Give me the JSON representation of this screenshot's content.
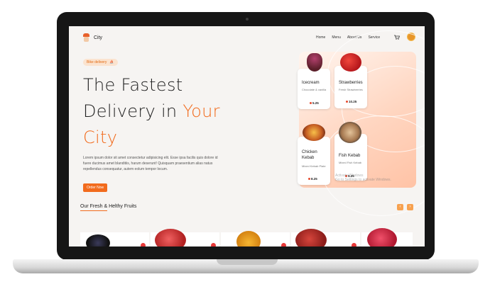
{
  "brand": {
    "name": "City"
  },
  "nav": {
    "items": [
      "Home",
      "Menu",
      "About Us",
      "Service"
    ],
    "cart_icon": "cart-icon",
    "avatar_icon": "avatar"
  },
  "hero": {
    "badge_label": "Bike delivery",
    "badge_icon": "scooter-icon",
    "line1": "The Fastest",
    "line2_prefix": "Delivery in",
    "line2_accent": "Your",
    "line3_accent": "City",
    "description": "Lorem ipsum dolor sit amet consectetur adipisicing elit. Esse ipsa facilis quis dolore id fuere ducimus amet blanditiis, harum deserunt! Quisquam praesentium alias natus repellendus consequatur, autem eolum tempor locum.",
    "order_button": "Order Now"
  },
  "featured": [
    {
      "name": "Icecream",
      "subtitle": "Chocolate & vanilla",
      "price": "5.25"
    },
    {
      "name": "Strawberries",
      "subtitle": "Fresh Strawberries",
      "price": "10.25"
    },
    {
      "name": "Chicken Kebab",
      "subtitle": "Mixed Kebab Plate",
      "price": "8.25"
    },
    {
      "name": "Fish Kebab",
      "subtitle": "Mixed Fish Kebab",
      "price": "5.25"
    }
  ],
  "watermark": {
    "line1": "Activate Windows",
    "line2": "Go to Settings to activate Windows."
  },
  "fruits_section": {
    "title_underlined": "Our Fresh",
    "title_rest": " & Helthy Fruits",
    "prev_icon": "chevron-left-icon",
    "next_icon": "chevron-right-icon"
  },
  "colors": {
    "accent": "#f26b1d",
    "panel": "#ffd6c1",
    "price_dot": "#e64a2e"
  }
}
